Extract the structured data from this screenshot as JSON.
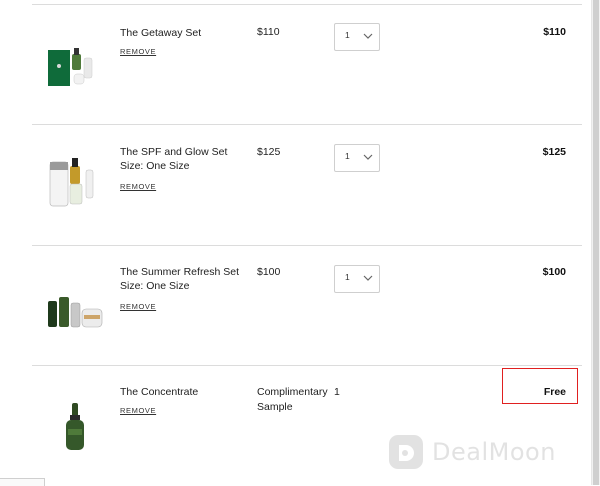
{
  "cart": {
    "remove_label": "REMOVE",
    "items": [
      {
        "name": "The Getaway Set",
        "size": "",
        "price": "$110",
        "qty": "1",
        "total": "$110"
      },
      {
        "name": "The SPF and Glow Set",
        "size": "Size: One Size",
        "price": "$125",
        "qty": "1",
        "total": "$125"
      },
      {
        "name": "The Summer Refresh Set",
        "size": "Size: One Size",
        "price": "$100",
        "qty": "1",
        "total": "$100"
      }
    ],
    "sample": {
      "name": "The Concentrate",
      "price_line1": "Complimentary",
      "price_line2": "Sample",
      "qty": "1",
      "total": "Free"
    }
  },
  "watermark": {
    "text": "DealMoon"
  },
  "colors": {
    "highlight": "#e02020",
    "divider": "#dcdcdc",
    "accent_green": "#0f6b3a"
  }
}
